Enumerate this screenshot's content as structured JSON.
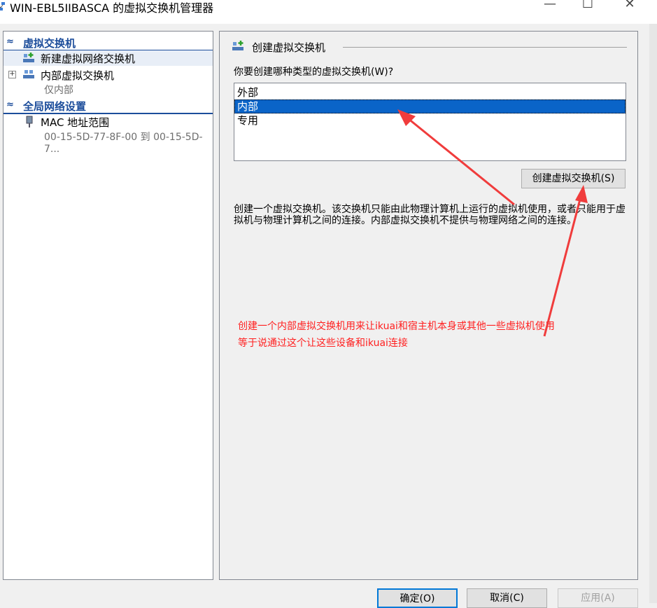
{
  "window": {
    "title": "WIN-EBL5IIBASCA 的虚拟交换机管理器",
    "minimize_glyph": "—",
    "maximize_glyph": "☐",
    "close_glyph": "✕",
    "icon": "network-app-icon"
  },
  "left_panel": {
    "sections": [
      {
        "title": "虚拟交换机",
        "chevron": "≈",
        "items": [
          {
            "label": "新建虚拟网络交换机",
            "icon": "new-switch-icon",
            "selected": true
          },
          {
            "label": "内部虚拟交换机",
            "icon": "switch-icon",
            "expandable": true,
            "expand_glyph": "+",
            "sub": "仅内部"
          }
        ]
      },
      {
        "title": "全局网络设置",
        "chevron": "≈",
        "items": [
          {
            "label": "MAC 地址范围",
            "icon": "mac-address-icon",
            "sub": "00-15-5D-77-8F-00 到 00-15-5D-7..."
          }
        ]
      }
    ]
  },
  "right_panel": {
    "section_title": "创建虚拟交换机",
    "section_icon": "new-switch-icon",
    "question": "你要创建哪种类型的虚拟交换机(W)?",
    "switch_types": [
      {
        "label": "外部",
        "selected": false
      },
      {
        "label": "内部",
        "selected": true
      },
      {
        "label": "专用",
        "selected": false
      }
    ],
    "create_button": "创建虚拟交换机(S)",
    "description": "创建一个虚拟交换机。该交换机只能由此物理计算机上运行的虚拟机使用，或者只能用于虚拟机与物理计算机之间的连接。内部虚拟交换机不提供与物理网络之间的连接。",
    "annotation_line1": "创建一个内部虚拟交换机用来让ikuai和宿主机本身或其他一些虚拟机使用",
    "annotation_line2": "等于说通过这个让这些设备和ikuai连接",
    "annotation_color": "#ff2020"
  },
  "buttons": {
    "ok": "确定(O)",
    "cancel": "取消(C)",
    "apply": "应用(A)"
  },
  "colors": {
    "section_header": "#1c4d9b",
    "selection": "#0a64c8",
    "arrow": "#f03c3c"
  }
}
